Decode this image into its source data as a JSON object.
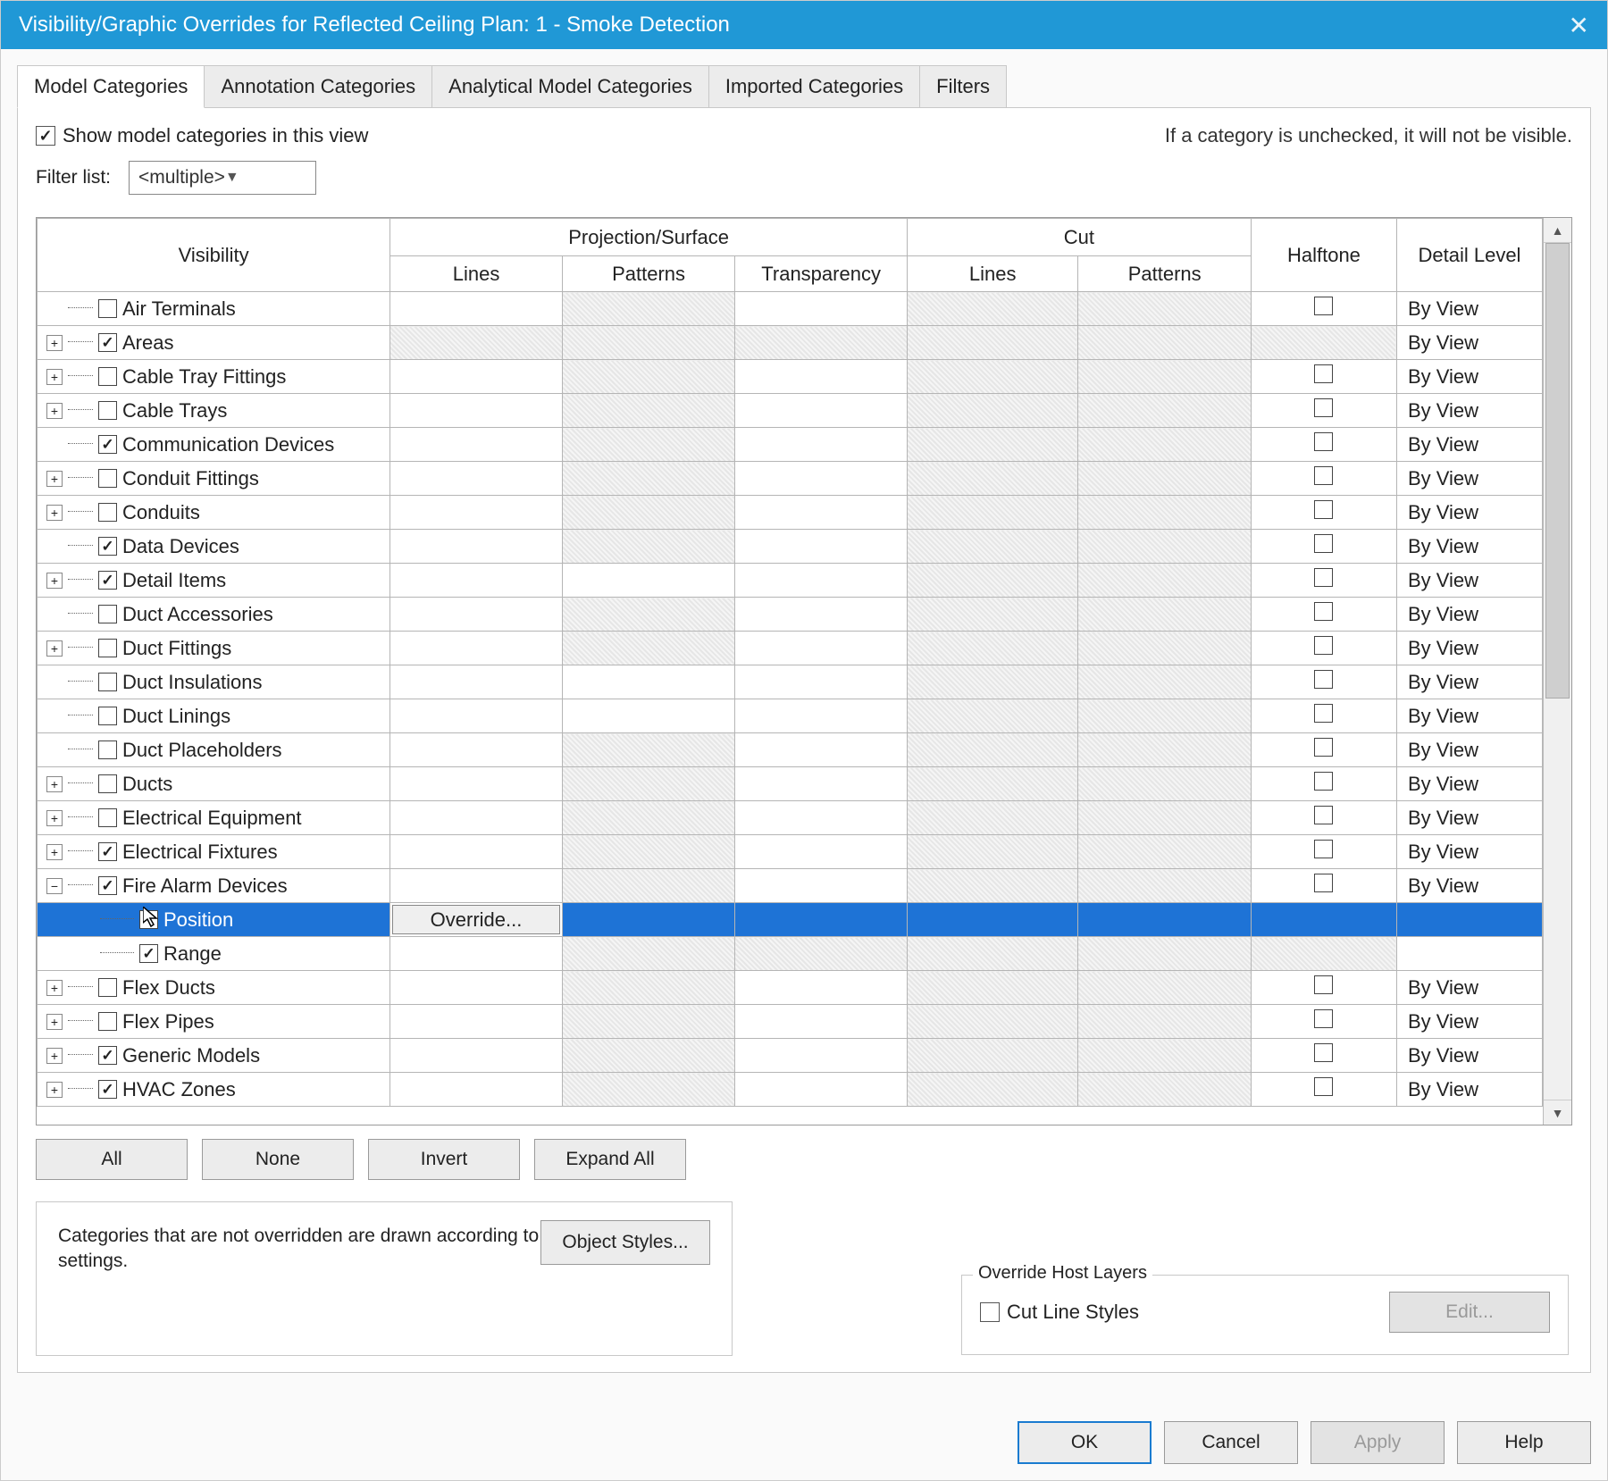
{
  "title": "Visibility/Graphic Overrides for Reflected Ceiling Plan: 1 - Smoke Detection",
  "tabs": [
    "Model Categories",
    "Annotation Categories",
    "Analytical Model Categories",
    "Imported Categories",
    "Filters"
  ],
  "show_label": "Show model categories in this view",
  "note": "If a category is unchecked, it will not be visible.",
  "filter_label": "Filter list:",
  "filter_value": "<multiple>",
  "headers": {
    "visibility": "Visibility",
    "proj": "Projection/Surface",
    "cut": "Cut",
    "half": "Halftone",
    "det": "Detail Level",
    "lines": "Lines",
    "patterns": "Patterns",
    "trans": "Transparency"
  },
  "rows": [
    {
      "name": "Air Terminals",
      "checked": false,
      "exp": false,
      "pat": true,
      "cut": true,
      "det": "By View"
    },
    {
      "name": "Areas",
      "checked": true,
      "exp": true,
      "plus": true,
      "allshade": true,
      "det": "By View"
    },
    {
      "name": "Cable Tray Fittings",
      "checked": false,
      "exp": true,
      "plus": true,
      "pat": true,
      "cut": true,
      "det": "By View"
    },
    {
      "name": "Cable Trays",
      "checked": false,
      "exp": true,
      "plus": true,
      "pat": true,
      "cut": true,
      "det": "By View"
    },
    {
      "name": "Communication Devices",
      "checked": true,
      "exp": false,
      "pat": true,
      "cut": true,
      "det": "By View"
    },
    {
      "name": "Conduit Fittings",
      "checked": false,
      "exp": true,
      "plus": true,
      "pat": true,
      "cut": true,
      "det": "By View"
    },
    {
      "name": "Conduits",
      "checked": false,
      "exp": true,
      "plus": true,
      "pat": true,
      "cut": true,
      "det": "By View"
    },
    {
      "name": "Data Devices",
      "checked": true,
      "exp": false,
      "pat": true,
      "cut": true,
      "det": "By View"
    },
    {
      "name": "Detail Items",
      "checked": true,
      "exp": true,
      "plus": true,
      "cut": true,
      "det": "By View"
    },
    {
      "name": "Duct Accessories",
      "checked": false,
      "exp": false,
      "pat": true,
      "cut": true,
      "det": "By View"
    },
    {
      "name": "Duct Fittings",
      "checked": false,
      "exp": true,
      "plus": true,
      "pat": true,
      "cut": true,
      "det": "By View"
    },
    {
      "name": "Duct Insulations",
      "checked": false,
      "exp": false,
      "cut": true,
      "det": "By View"
    },
    {
      "name": "Duct Linings",
      "checked": false,
      "exp": false,
      "cut": true,
      "det": "By View"
    },
    {
      "name": "Duct Placeholders",
      "checked": false,
      "exp": false,
      "pat": true,
      "cut": true,
      "det": "By View"
    },
    {
      "name": "Ducts",
      "checked": false,
      "exp": true,
      "plus": true,
      "pat": true,
      "cut": true,
      "det": "By View"
    },
    {
      "name": "Electrical Equipment",
      "checked": false,
      "exp": true,
      "plus": true,
      "pat": true,
      "cut": true,
      "det": "By View"
    },
    {
      "name": "Electrical Fixtures",
      "checked": true,
      "exp": true,
      "plus": true,
      "pat": true,
      "cut": true,
      "det": "By View"
    },
    {
      "name": "Fire Alarm Devices",
      "checked": true,
      "exp": true,
      "plus": false,
      "pat": true,
      "cut": true,
      "det": "By View"
    },
    {
      "name": "Position",
      "checked": false,
      "child": true,
      "selected": true,
      "override": "Override..."
    },
    {
      "name": "Range",
      "checked": true,
      "child": true,
      "pat": true,
      "allshade2": true
    },
    {
      "name": "Flex Ducts",
      "checked": false,
      "exp": true,
      "plus": true,
      "pat": true,
      "cut": true,
      "det": "By View"
    },
    {
      "name": "Flex Pipes",
      "checked": false,
      "exp": true,
      "plus": true,
      "pat": true,
      "cut": true,
      "det": "By View"
    },
    {
      "name": "Generic Models",
      "checked": true,
      "exp": true,
      "plus": true,
      "pat": true,
      "cut": true,
      "det": "By View"
    },
    {
      "name": "HVAC Zones",
      "checked": true,
      "exp": true,
      "plus": true,
      "pat": true,
      "cut": true,
      "det": "By View"
    }
  ],
  "buttons": {
    "all": "All",
    "none": "None",
    "invert": "Invert",
    "expand": "Expand All",
    "objstyles": "Object Styles...",
    "edit": "Edit...",
    "ok": "OK",
    "cancel": "Cancel",
    "apply": "Apply",
    "help": "Help"
  },
  "info_text": "Categories that are not overridden are drawn according to Object Style settings.",
  "host_legend": "Override Host Layers",
  "cut_line_styles": "Cut Line Styles"
}
